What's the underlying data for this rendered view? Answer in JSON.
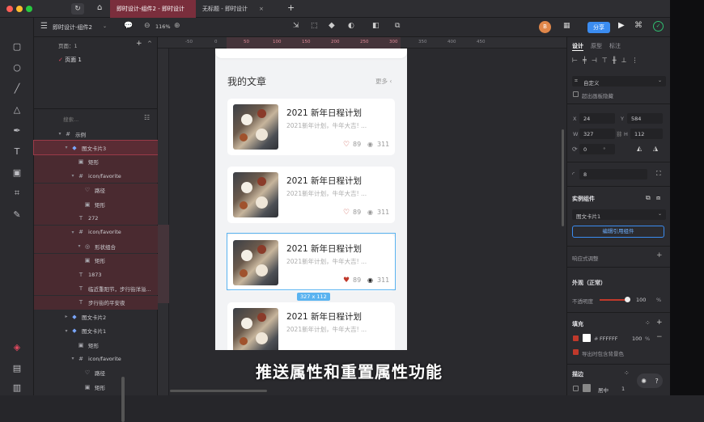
{
  "tabs": [
    "即时设计-组件2 - 即时设计",
    "无标题 - 即时设计"
  ],
  "toolbar": {
    "project": "即时设计-组件2",
    "zoom": "116%",
    "share": "分享"
  },
  "pages": {
    "label": "页面：1",
    "items": [
      "页面 1"
    ]
  },
  "search_placeholder": "搜索...",
  "layers": [
    {
      "name": "示例",
      "depth": 0
    },
    {
      "name": "图文卡片3",
      "depth": 1
    },
    {
      "name": "矩形",
      "depth": 2
    },
    {
      "name": "icon/favorite",
      "depth": 2
    },
    {
      "name": "路径",
      "depth": 3
    },
    {
      "name": "矩形",
      "depth": 3
    },
    {
      "name": "272",
      "depth": 2
    },
    {
      "name": "icon/favorite",
      "depth": 2
    },
    {
      "name": "形状组合",
      "depth": 3
    },
    {
      "name": "矩形",
      "depth": 3
    },
    {
      "name": "1873",
      "depth": 2
    },
    {
      "name": "临近重阳节，步行街洋溢...",
      "depth": 2
    },
    {
      "name": "步行街的平安夜",
      "depth": 2
    },
    {
      "name": "图文卡片2",
      "depth": 1
    },
    {
      "name": "图文卡片1",
      "depth": 1
    },
    {
      "name": "矩形",
      "depth": 2
    },
    {
      "name": "icon/favorite",
      "depth": 2
    },
    {
      "name": "路径",
      "depth": 3
    },
    {
      "name": "矩形",
      "depth": 3
    }
  ],
  "ruler_marks": [
    "-50",
    "0",
    "50",
    "100",
    "150",
    "200",
    "250",
    "300",
    "350",
    "400",
    "450"
  ],
  "phone": {
    "section_title": "我的文章",
    "more": "更多",
    "cards": [
      {
        "title": "2021 新年日程计划",
        "subtitle": "2021新年计划，牛年大吉! ...",
        "likes": "89",
        "views": "311"
      },
      {
        "title": "2021 新年日程计划",
        "subtitle": "2021新年计划，牛年大吉! ...",
        "likes": "89",
        "views": "311"
      },
      {
        "title": "2021 新年日程计划",
        "subtitle": "2021新年计划，牛年大吉! ...",
        "likes": "89",
        "views": "311"
      },
      {
        "title": "2021 新年日程计划",
        "subtitle": "2021新年计划，牛年大吉! ...",
        "likes": "",
        "views": ""
      }
    ],
    "selection_size": "327 x 112"
  },
  "inspector": {
    "tabs": [
      "设计",
      "原型",
      "标注"
    ],
    "frame_type": "自定义",
    "clip_label": "超出画板隐藏",
    "x": "24",
    "y": "584",
    "w": "327",
    "h": "112",
    "rotation": "0",
    "rotation_unit": "°",
    "radius": "8",
    "component_section": "实例组件",
    "component_name": "图文卡片1",
    "edit_button": "编辑引用组件",
    "responsive": "响应式调整",
    "appearance": "外观（正常）",
    "opacity_label": "不透明度",
    "opacity": "100",
    "opacity_unit": "%",
    "fill_section": "填充",
    "fill_hex": "FFFFFF",
    "fill_opacity": "100",
    "export_bg": "导出时包含背景色",
    "stroke_section": "描边",
    "stroke_align": "居中",
    "stroke_width": "1"
  },
  "subtitle": "推送属性和重置属性功能",
  "colors": {
    "accent": "#3b8cf0",
    "tab_active": "#7a2e3c",
    "selection": "#5ab3f0",
    "heart": "#c0392b"
  }
}
